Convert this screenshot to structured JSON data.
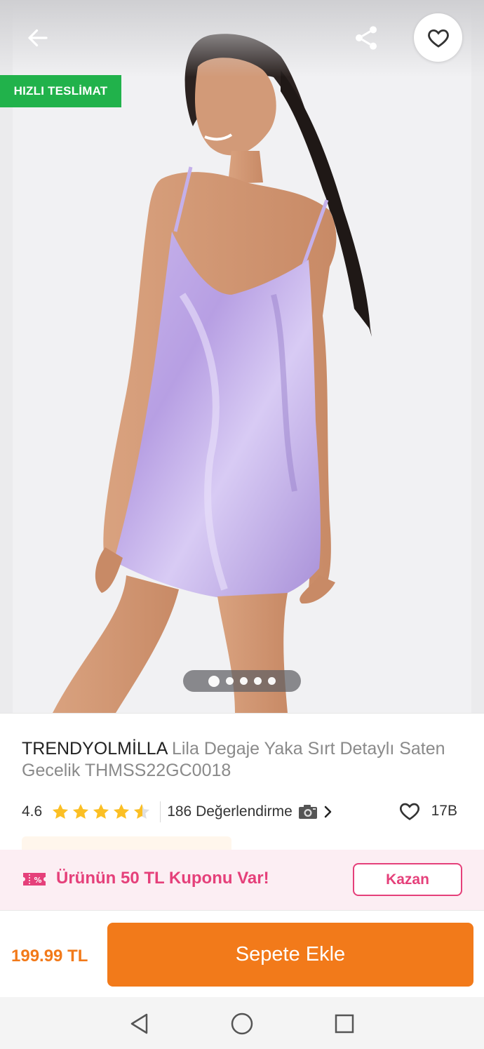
{
  "header": {
    "back_icon": "arrow-left-icon",
    "share_icon": "share-icon",
    "favorite_icon": "heart-outline-icon"
  },
  "badge": {
    "label": "HIZLI TESLİMAT",
    "color": "#21b24b"
  },
  "gallery": {
    "image_count": 5,
    "active_index": 1
  },
  "product": {
    "brand": "TRENDYOLMİLLA",
    "name": "Lila Degaje Yaka Sırt Detaylı Saten Gecelik THMSS22GC0018",
    "rating": "4.6",
    "rating_value": 4.6,
    "reviews_label": "186 Değerlendirme",
    "favorites_count": "17B"
  },
  "coupon": {
    "text": "Ürünün 50 TL Kuponu Var!",
    "button_label": "Kazan",
    "icon": "coupon-ticket-icon",
    "color": "#e5407a"
  },
  "purchase": {
    "price": "199.99 TL",
    "add_to_cart_label": "Sepete Ekle",
    "accent": "#f27a1a"
  },
  "system_nav": {
    "back": "nav-back-icon",
    "home": "nav-home-icon",
    "recents": "nav-recents-icon"
  }
}
